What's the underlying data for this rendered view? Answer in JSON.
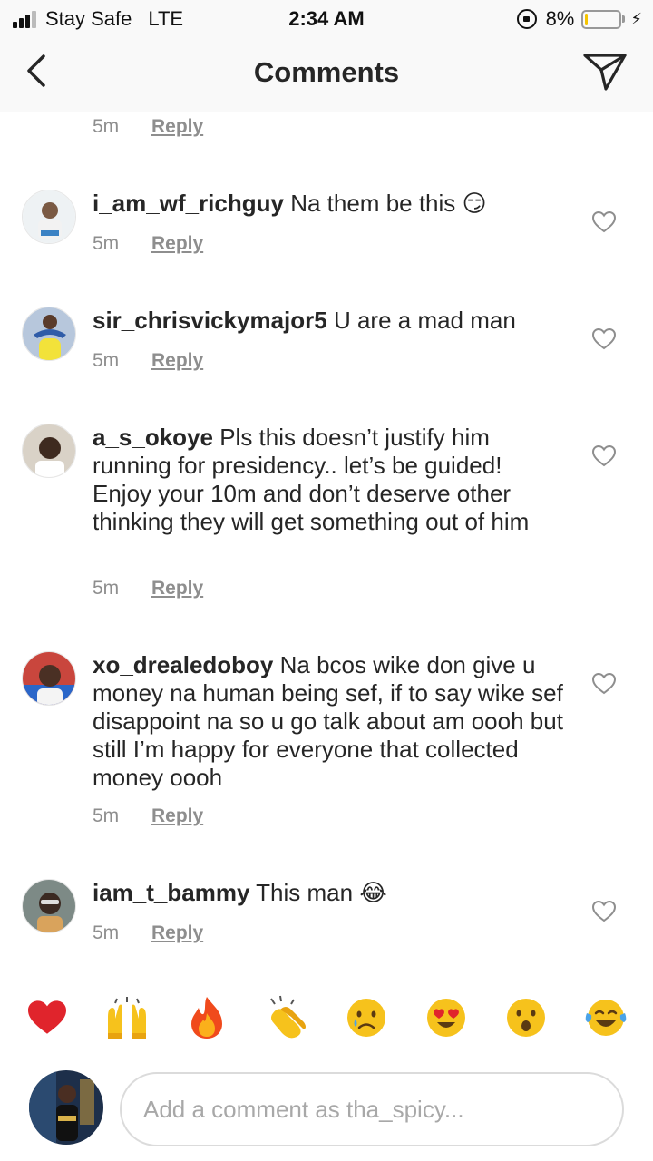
{
  "status_bar": {
    "carrier": "Stay Safe",
    "network": "LTE",
    "time": "2:34 AM",
    "battery": "8%",
    "battery_level": 0.08
  },
  "header": {
    "title": "Comments",
    "back_icon": "chevron-left-icon",
    "send_icon": "paper-plane-icon"
  },
  "top_partial": {
    "time": "5m",
    "reply": "Reply"
  },
  "comments": [
    {
      "username": "i_am_wf_richguy",
      "text": " Na them be this 😏",
      "time": "5m",
      "reply": "Reply"
    },
    {
      "username": "sir_chrisvickymajor5",
      "text": " U are a mad man",
      "time": "5m",
      "reply": "Reply"
    },
    {
      "username": "a_s_okoye",
      "text": " Pls this doesn’t justify him running for presidency.. let’s be guided! Enjoy your 10m and don’t deserve other thinking they will get something out of him",
      "time": "5m",
      "reply": "Reply"
    },
    {
      "username": "xo_drealedoboy",
      "text": " Na bcos wike don give u money na human being sef, if to say wike sef disappoint na so u go talk about am oooh but still I’m happy for everyone that collected money oooh",
      "time": "5m",
      "reply": "Reply"
    },
    {
      "username": "iam_t_bammy",
      "text": " This man 😂",
      "time": "5m",
      "reply": "Reply"
    }
  ],
  "emoji_bar": [
    {
      "name": "red-heart-emoji",
      "glyph": "❤️"
    },
    {
      "name": "raising-hands-emoji",
      "glyph": "🙌"
    },
    {
      "name": "fire-emoji",
      "glyph": "🔥"
    },
    {
      "name": "clapping-hands-emoji",
      "glyph": "👏"
    },
    {
      "name": "crying-face-emoji",
      "glyph": "😢"
    },
    {
      "name": "heart-eyes-emoji",
      "glyph": "😍"
    },
    {
      "name": "surprised-face-emoji",
      "glyph": "😮"
    },
    {
      "name": "tears-of-joy-emoji",
      "glyph": "😂"
    }
  ],
  "composer": {
    "placeholder": "Add a comment as tha_spicy..."
  },
  "colors": {
    "text": "#262626",
    "secondary": "#8e8e8e",
    "divider": "#dbdbdb",
    "battery_low": "#f5c400"
  }
}
